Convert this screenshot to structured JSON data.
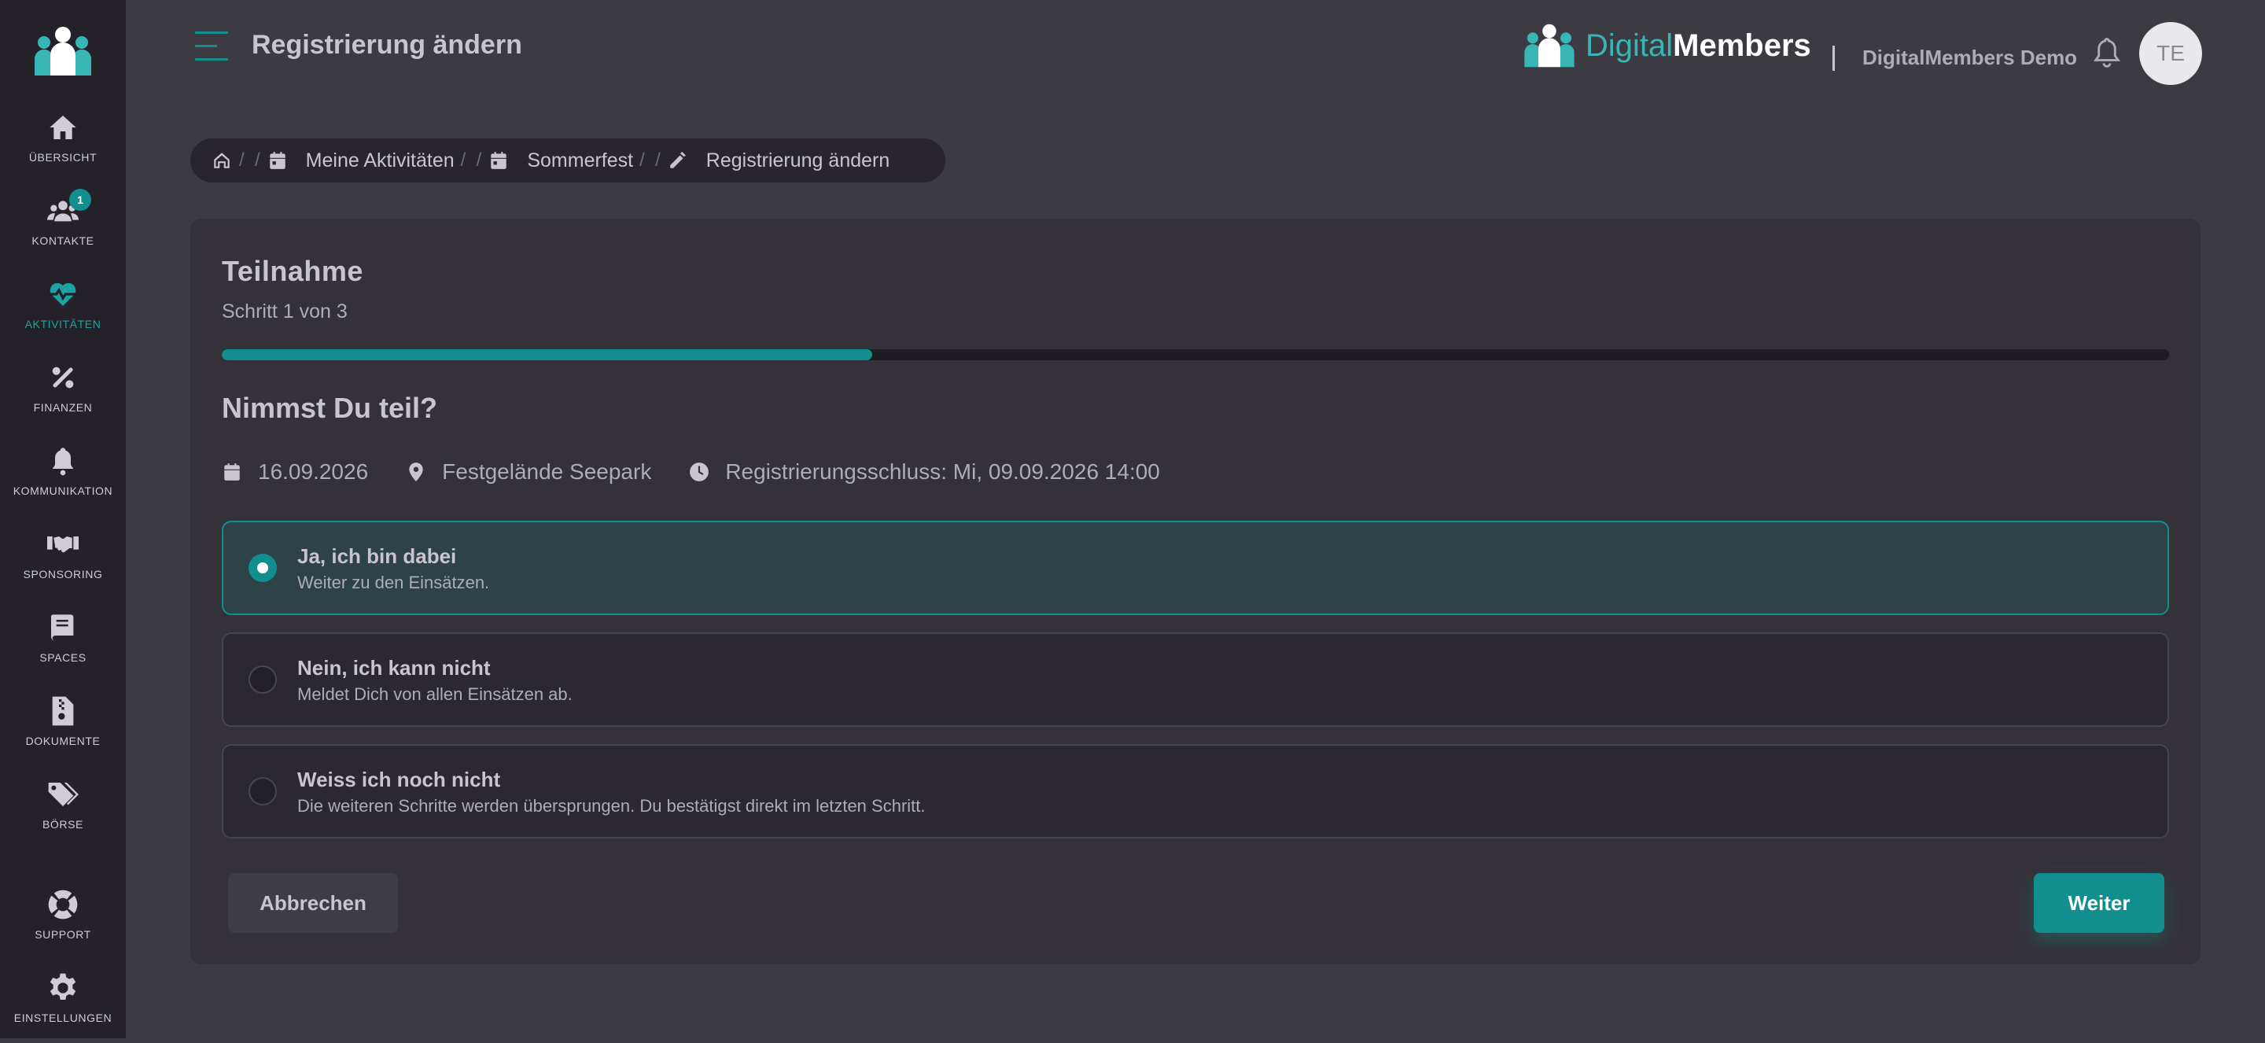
{
  "colors": {
    "accent": "#138e8e",
    "sidebar_bg": "#242228",
    "page_bg": "#3d3b42",
    "card_bg": "#343238"
  },
  "sidebar": {
    "items": [
      {
        "label": "ÜBERSICHT",
        "icon": "home-icon"
      },
      {
        "label": "KONTAKTE",
        "icon": "users-icon",
        "badge": "1"
      },
      {
        "label": "AKTIVITÄTEN",
        "icon": "heart-pulse-icon",
        "active": true
      },
      {
        "label": "FINANZEN",
        "icon": "percent-icon"
      },
      {
        "label": "KOMMUNIKATION",
        "icon": "bell-icon"
      },
      {
        "label": "SPONSORING",
        "icon": "handshake-icon"
      },
      {
        "label": "SPACES",
        "icon": "book-icon"
      },
      {
        "label": "DOKUMENTE",
        "icon": "file-archive-icon"
      },
      {
        "label": "BÖRSE",
        "icon": "tags-icon"
      },
      {
        "label": "SUPPORT",
        "icon": "lifebuoy-icon"
      },
      {
        "label": "EINSTELLUNGEN",
        "icon": "gear-icon"
      }
    ]
  },
  "header": {
    "title": "Registrierung ändern",
    "brand_part1": "Digital",
    "brand_part2": "Members",
    "org_name": "DigitalMembers Demo",
    "avatar_initials": "TE"
  },
  "breadcrumb": {
    "items": [
      {
        "label": "Meine Aktivitäten",
        "icon": "calendar-icon"
      },
      {
        "label": "Sommerfest",
        "icon": "calendar-icon"
      },
      {
        "label": "Registrierung ändern",
        "icon": "pencil-icon"
      }
    ]
  },
  "card": {
    "title": "Teilnahme",
    "step": "Schritt 1 von 3",
    "progress": 0.334,
    "question": "Nimmst Du teil?",
    "meta": {
      "date": "16.09.2026",
      "location": "Festgelände Seepark",
      "deadline": "Registrierungsschluss: Mi, 09.09.2026 14:00"
    },
    "options": [
      {
        "label": "Ja, ich bin dabei",
        "description": "Weiter zu den Einsätzen.",
        "selected": true
      },
      {
        "label": "Nein, ich kann nicht",
        "description": "Meldet Dich von allen Einsätzen ab.",
        "selected": false
      },
      {
        "label": "Weiss ich noch nicht",
        "description": "Die weiteren Schritte werden übersprungen. Du bestätigst direkt im letzten Schritt.",
        "selected": false
      }
    ],
    "cancel_label": "Abbrechen",
    "next_label": "Weiter"
  }
}
